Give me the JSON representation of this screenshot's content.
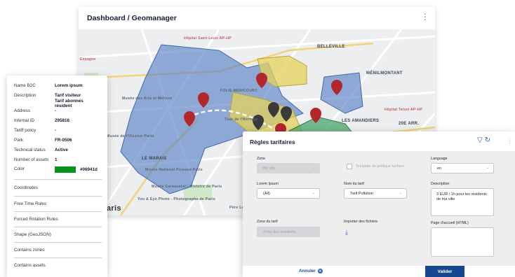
{
  "dashboard": {
    "title": "Dashboard / Geomanager",
    "map_labels": {
      "hospital1": "Hôpital Saint-Louis AP-HP",
      "espagne": "Espagne",
      "belleville": "BELLEVILLE",
      "menilmontant": "MÉNILMONTANT",
      "folie": "FOLIE-MÉRICOURT",
      "amandiers": "LES AMANDIERS",
      "hospital2": "Hôpital Tenon AP-HP",
      "arr": "20E ARR.",
      "musee_arts": "Musée des Arts et Métiers",
      "marais": "LE MARAIS",
      "picasso": "Musée National Picasso-Paris",
      "carnavalet": "Musée Carnavalet - Histoire de Paris",
      "photo": "You & Eye Photo - Photographe de Paris",
      "paris": "aris",
      "pere": "Père Lachaise",
      "tour": "Tour de l'Horloge",
      "ecole": "Musée de l'Illusion Paris"
    }
  },
  "info": {
    "rows": [
      {
        "key": "Name B2C",
        "value": "Lorem ipsum"
      },
      {
        "key": "Description",
        "value": "Tarif visiteur",
        "value2": "Tarif abonnés résident"
      },
      {
        "key": "Address",
        "value": "-"
      },
      {
        "key": "Internal ID",
        "value": "295816"
      },
      {
        "key": "Tariff policy",
        "value": "-"
      },
      {
        "key": "Park",
        "value": "FR-0506"
      },
      {
        "key": "Technical status",
        "value": "Active"
      },
      {
        "key": "Number of assets",
        "value": "1"
      },
      {
        "key": "Color",
        "value": "#06941d"
      }
    ],
    "color_hex": "#06941d",
    "sections": [
      "Coordinates",
      "Free Time Rules",
      "Forced Rotation Rules",
      "Shape (GeoJSON)",
      "Contains zones",
      "Contains assets"
    ]
  },
  "rules": {
    "title": "Règles tarifaires",
    "zone_label": "Zone",
    "zone_value": "My city",
    "template_label": "Template de politique tarifaire",
    "language_label": "Language",
    "language_value": "en",
    "lorem_label": "Lorem Ipsum",
    "lorem_value": "(All)",
    "tarif_name_label": "Nom du tarif",
    "tarif_name_value": "Tarif Pollution",
    "description_label": "Description",
    "description_value": "3 EUR / 1h pour les résidents de ma ville",
    "zone_tarif_label": "Zone du tarif",
    "zone_tarif_value": "Zone des residents",
    "import_label": "Importer des fichiers",
    "home_label": "Page d'accueil (HTML)",
    "cancel_label": "Annuler",
    "validate_label": "Valider"
  }
}
